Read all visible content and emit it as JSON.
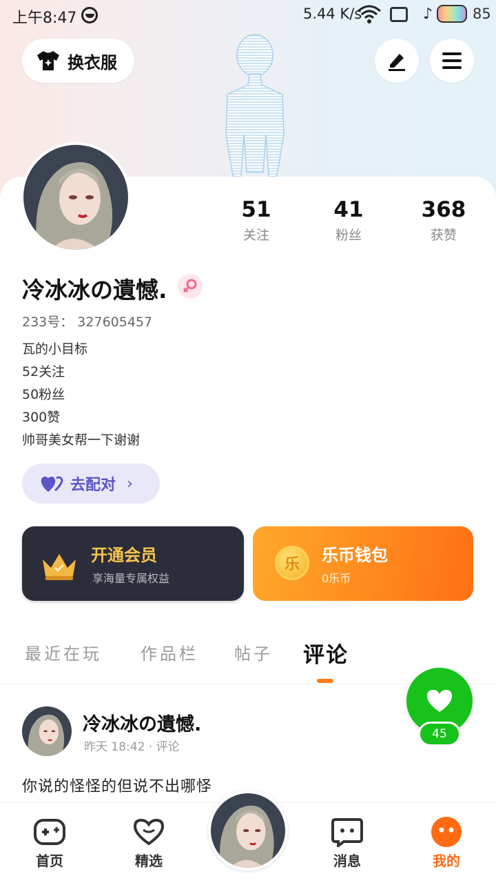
{
  "status_bar": {
    "time": "上午8:47",
    "net_speed": "5.44 K/s",
    "battery": "85"
  },
  "header": {
    "outfit_label": "换衣服",
    "edit_icon": "pen-icon",
    "menu_icon": "menu-icon"
  },
  "profile": {
    "name": "冷冰冰の遺憾.",
    "id_line": "233号： 327605457",
    "bio_lines": [
      "瓦的小目标",
      "52关注",
      "50粉丝",
      "300赞",
      "帅哥美女帮一下谢谢"
    ],
    "stats": [
      {
        "num": "51",
        "label": "关注"
      },
      {
        "num": "41",
        "label": "粉丝"
      },
      {
        "num": "368",
        "label": "获赞"
      }
    ]
  },
  "match": {
    "label": "去配对",
    "chevron": "›"
  },
  "vip": {
    "title": "开通会员",
    "subtitle": "享海量专属权益"
  },
  "wallet": {
    "title": "乐币钱包",
    "subtitle": "0乐币",
    "coin_glyph": "乐"
  },
  "tabs": [
    "最近在玩",
    "作品栏",
    "帖子",
    "评论"
  ],
  "active_tab": "评论",
  "comment": {
    "author": "冷冰冰の遺憾.",
    "meta": "昨天 18:42 · 评论",
    "text": "你说的怪怪的但说不出哪怪"
  },
  "like": {
    "count": "45"
  },
  "nav": {
    "home": "首页",
    "featured": "精选",
    "messages": "消息",
    "mine": "我的"
  },
  "colors": {
    "accent_orange": "#ff6a12",
    "like_green": "#17c21a",
    "vip_gold": "#f5c44c",
    "match_purple": "#5a55c8"
  }
}
